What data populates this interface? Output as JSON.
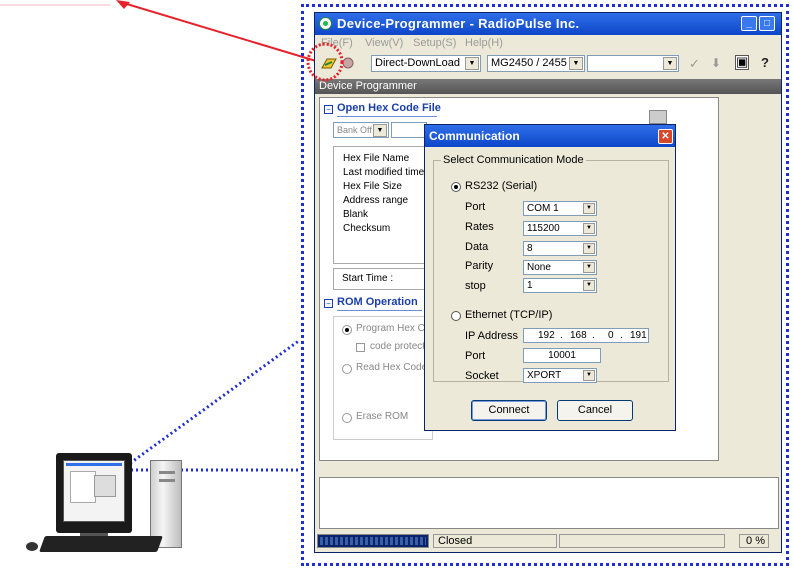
{
  "window": {
    "title": "Device-Programmer - RadioPulse Inc.",
    "min_glyph": "_",
    "max_glyph": "□",
    "close_glyph": "✕"
  },
  "menu": [
    "File(F)",
    "View(V)",
    "Setup(S)",
    "Help(H)"
  ],
  "toolbar": {
    "mode": "Direct-DownLoad",
    "device": "MG2450 / 2455",
    "extra": "",
    "check_glyph": "✓",
    "down_glyph": "⬇",
    "disk_glyph": "▣",
    "help_glyph": "?"
  },
  "panel_bar": "Device Programmer",
  "hex_section": {
    "title": "Open Hex Code File",
    "bank": "Bank Off",
    "fields": [
      "Hex File Name",
      "Last modified time",
      "Hex File Size",
      "Address range",
      "Blank",
      "Checksum"
    ],
    "start_time": "Start Time   :"
  },
  "rom_section": {
    "title": "ROM Operation",
    "program": "Program Hex Code",
    "code_protect": "code protection",
    "read": "Read Hex Code",
    "erase": "Erase ROM"
  },
  "status": {
    "state": "Closed",
    "percent": "0 %"
  },
  "dialog": {
    "title": "Communication",
    "group": "Select Communication Mode",
    "rs232_label": "RS232 (Serial)",
    "rs232_selected": true,
    "port_label": "Port",
    "port": "COM 1",
    "rates_label": "Rates",
    "rates": "115200",
    "data_label": "Data",
    "data": "8",
    "parity_label": "Parity",
    "parity": "None",
    "stop_label": "stop",
    "stop": "1",
    "ethernet_label": "Ethernet (TCP/IP)",
    "ip_label": "IP Address",
    "ip": [
      "192",
      "168",
      "0",
      "191"
    ],
    "eport_label": "Port",
    "eport": "10001",
    "socket_label": "Socket",
    "socket": "XPORT",
    "connect": "Connect",
    "cancel": "Cancel"
  },
  "colors": {
    "callout_blue": "#1f2fd8",
    "arrow_red": "#e8202a",
    "title_blue": "#0d46c9"
  }
}
